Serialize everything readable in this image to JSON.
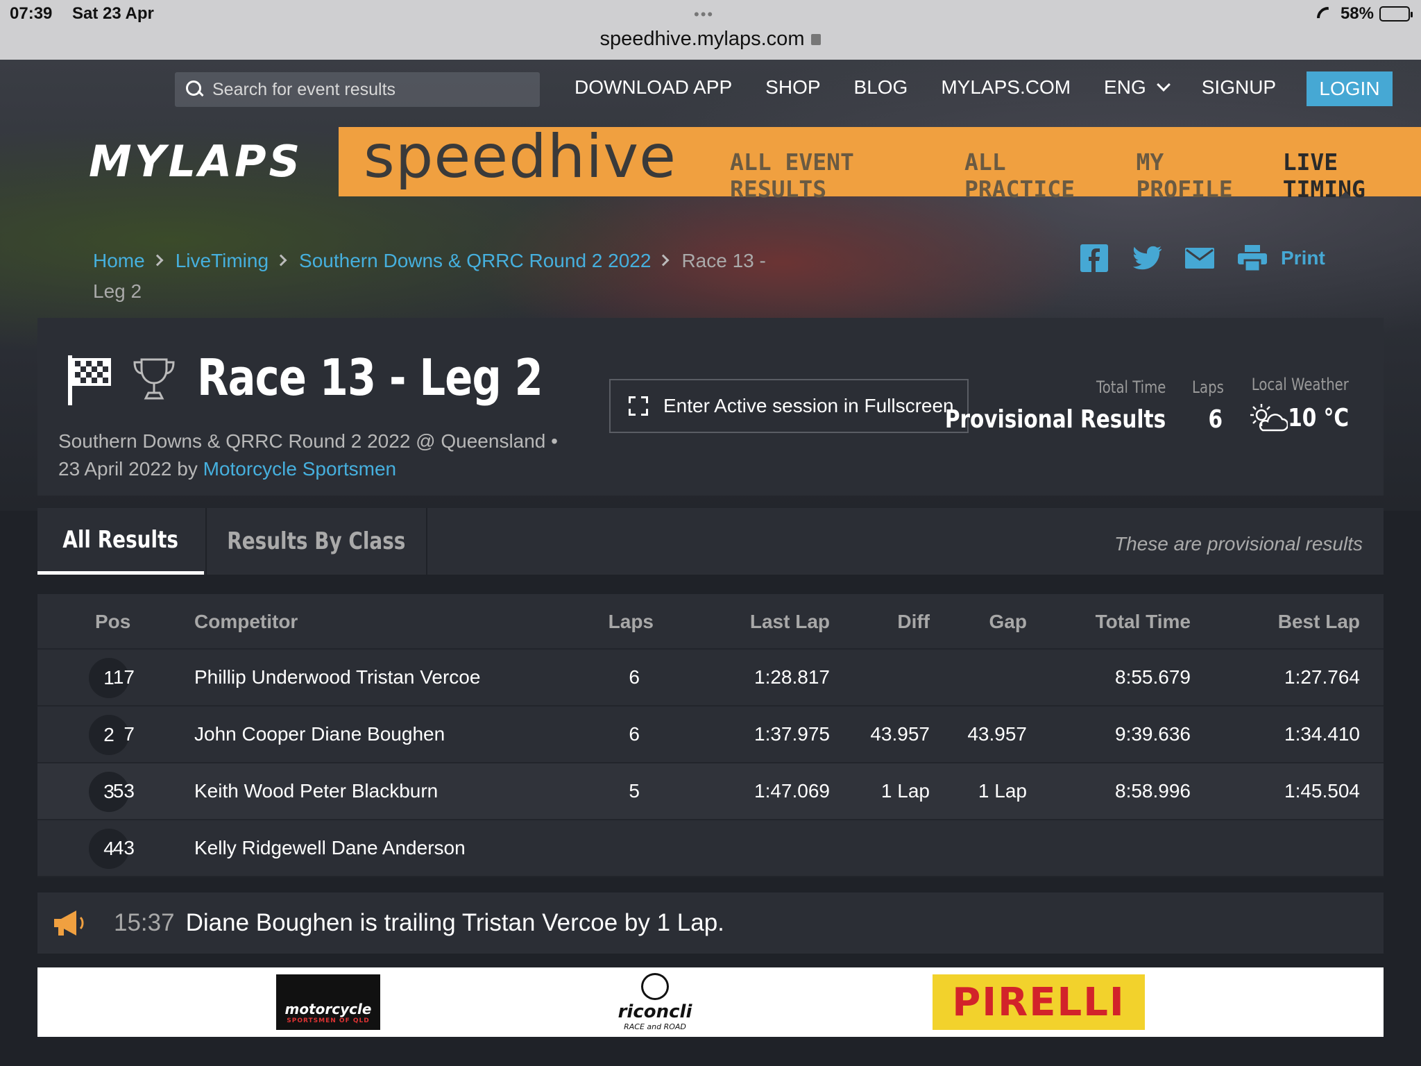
{
  "status": {
    "time": "07:39",
    "date": "Sat 23 Apr",
    "url": "speedhive.mylaps.com",
    "battery": "58%"
  },
  "topnav": {
    "search_placeholder": "Search for event results",
    "items": [
      "DOWNLOAD APP",
      "SHOP",
      "BLOG",
      "MYLAPS.COM"
    ],
    "lang": "ENG",
    "signup": "SIGNUP",
    "login": "LOGIN"
  },
  "brand": {
    "mylaps": "MYLAPS",
    "speedhive": "speedhive",
    "nav": [
      "ALL EVENT RESULTS",
      "ALL PRACTICE",
      "MY PROFILE",
      "LIVE TIMING"
    ]
  },
  "breadcrumb": {
    "home": "Home",
    "livetiming": "LiveTiming",
    "event": "Southern Downs & QRRC Round 2 2022",
    "current": "Race 13 - Leg 2",
    "print": "Print"
  },
  "race": {
    "title": "Race 13 - Leg 2",
    "subtitle": "Southern Downs & QRRC Round 2 2022 @ Queensland •",
    "date_by": "23 April 2022 by",
    "organizer": "Motorcycle Sportsmen",
    "fullscreen_label": "Enter Active session in Fullscreen",
    "total_time_label": "Total Time",
    "total_time_value": "Provisional Results",
    "laps_label": "Laps",
    "laps_value": "6",
    "weather_label": "Local Weather",
    "weather_value": "10 °C"
  },
  "tabs": {
    "all": "All Results",
    "by_class": "Results By Class",
    "note": "These are provisional results"
  },
  "table": {
    "headers": {
      "pos": "Pos",
      "competitor": "Competitor",
      "laps": "Laps",
      "last_lap": "Last Lap",
      "diff": "Diff",
      "gap": "Gap",
      "total_time": "Total Time",
      "best_lap": "Best Lap"
    },
    "rows": [
      {
        "pos": "1",
        "num": "17",
        "name": "Phillip Underwood Tristan Vercoe",
        "laps": "6",
        "last": "1:28.817",
        "diff": "",
        "gap": "",
        "total": "8:55.679",
        "best": "1:27.764"
      },
      {
        "pos": "2",
        "num": "7",
        "name": "John Cooper Diane Boughen",
        "laps": "6",
        "last": "1:37.975",
        "diff": "43.957",
        "gap": "43.957",
        "total": "9:39.636",
        "best": "1:34.410"
      },
      {
        "pos": "3",
        "num": "53",
        "name": "Keith Wood Peter Blackburn",
        "laps": "5",
        "last": "1:47.069",
        "diff": "1 Lap",
        "gap": "1 Lap",
        "total": "8:58.996",
        "best": "1:45.504"
      },
      {
        "pos": "4",
        "num": "43",
        "name": "Kelly Ridgewell Dane Anderson",
        "laps": "",
        "last": "",
        "diff": "",
        "gap": "",
        "total": "",
        "best": ""
      }
    ]
  },
  "notification": {
    "time": "15:37",
    "text": "Diane Boughen is trailing Tristan Vercoe by 1 Lap."
  },
  "sponsors": {
    "s1": "motorcycle",
    "s1_sub": "SPORTSMEN OF QLD",
    "s2": "riconcli",
    "s2_sub": "RACE and ROAD",
    "s3": "PIRELLI"
  },
  "colors": {
    "accent": "#46a8d4",
    "brand_orange": "#f0a040",
    "panel": "#2b2e35"
  }
}
